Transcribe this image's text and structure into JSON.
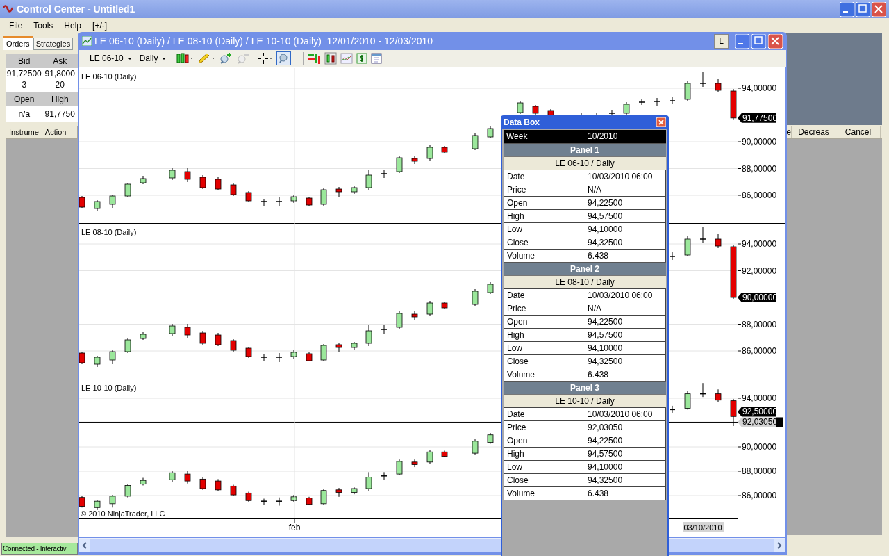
{
  "window": {
    "title": "Control Center - Untitled1"
  },
  "menu": [
    "File",
    "Tools",
    "Help",
    "[+/-]"
  ],
  "tabs": [
    {
      "label": "Orders",
      "selected": true
    },
    {
      "label": "Strategies",
      "selected": false
    }
  ],
  "quote": {
    "header_1": [
      "Bid",
      "Ask"
    ],
    "row_1": [
      "91,72500",
      "91,8000"
    ],
    "row_2": [
      "3",
      "20"
    ],
    "header_2": [
      "Open",
      "High"
    ],
    "row_3": [
      "n/a",
      "91,7750"
    ]
  },
  "order_columns": [
    "Instrume",
    "Action"
  ],
  "right_columns": [
    "e",
    "Decreas",
    "Cancel"
  ],
  "status_bar": "Connected - Interactiv",
  "chart_window": {
    "title": "LE 06-10 (Daily) / LE 08-10 (Daily) / LE 10-10 (Daily)  12/01/2010 - 12/03/2010",
    "badge": "L",
    "toolbar": {
      "instrument": "LE 06-10",
      "interval": "Daily"
    },
    "panels": [
      {
        "label": "LE 06-10 (Daily)",
        "price_ticks": [
          "94,00000",
          "90,00000",
          "88,00000",
          "86,00000"
        ],
        "markers": [
          {
            "text": "91,77500",
            "kind": "last"
          }
        ]
      },
      {
        "label": "LE 08-10 (Daily)",
        "price_ticks": [
          "94,00000",
          "92,00000",
          "88,00000",
          "86,00000"
        ],
        "markers": [
          {
            "text": "90,00000",
            "kind": "last"
          }
        ]
      },
      {
        "label": "LE 10-10 (Daily)",
        "price_ticks": [
          "94,00000",
          "90,00000",
          "88,00000",
          "86,00000"
        ],
        "markers": [
          {
            "text": "92,50000",
            "kind": "last"
          },
          {
            "text": "92,03050",
            "kind": "cursor"
          }
        ]
      }
    ],
    "x_labels": [
      "feb"
    ],
    "cursor_date": "03/10/2010",
    "copyright": "© 2010 NinjaTrader, LLC"
  },
  "data_box": {
    "title": "Data Box",
    "header": [
      "Week",
      "10/2010"
    ],
    "panels": [
      {
        "title": "Panel 1",
        "series": "LE 06-10 / Daily",
        "rows": [
          [
            "Date",
            "10/03/2010 06:00"
          ],
          [
            "Price",
            "N/A"
          ],
          [
            "Open",
            "94,22500"
          ],
          [
            "High",
            "94,57500"
          ],
          [
            "Low",
            "94,10000"
          ],
          [
            "Close",
            "94,32500"
          ],
          [
            "Volume",
            "6.438"
          ]
        ]
      },
      {
        "title": "Panel 2",
        "series": "LE 08-10 / Daily",
        "rows": [
          [
            "Date",
            "10/03/2010 06:00"
          ],
          [
            "Price",
            "N/A"
          ],
          [
            "Open",
            "94,22500"
          ],
          [
            "High",
            "94,57500"
          ],
          [
            "Low",
            "94,10000"
          ],
          [
            "Close",
            "94,32500"
          ],
          [
            "Volume",
            "6.438"
          ]
        ]
      },
      {
        "title": "Panel 3",
        "series": "LE 10-10 / Daily",
        "rows": [
          [
            "Date",
            "10/03/2010 06:00"
          ],
          [
            "Price",
            "92,03050"
          ],
          [
            "Open",
            "94,22500"
          ],
          [
            "High",
            "94,57500"
          ],
          [
            "Low",
            "94,10000"
          ],
          [
            "Close",
            "94,32500"
          ],
          [
            "Volume",
            "6.438"
          ]
        ]
      }
    ]
  }
}
